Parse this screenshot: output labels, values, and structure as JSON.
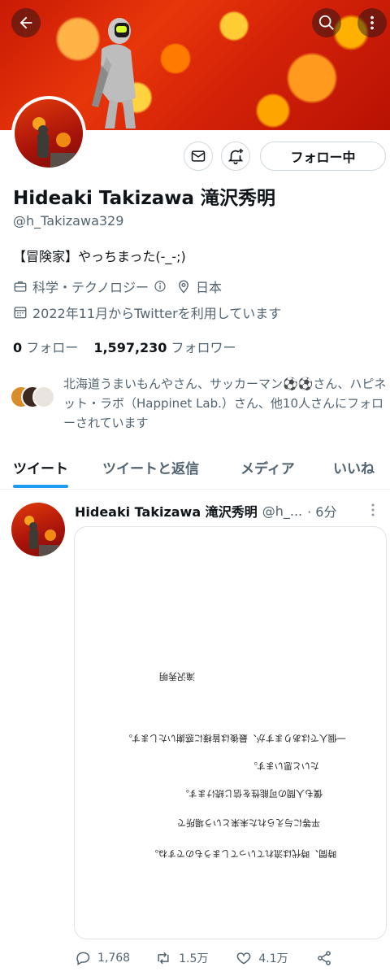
{
  "profile": {
    "name": "Hideaki Takizawa 滝沢秀明",
    "handle": "@h_Takizawa329",
    "bio": "【冒険家】やっちまった(-_-;)",
    "category": "科学・テクノロジー",
    "location": "日本",
    "joined": "2022年11月からTwitterを利用しています",
    "following_count": "0",
    "following_label": "フォロー",
    "followers_count": "1,597,230",
    "followers_label": "フォロワー",
    "follow_button": "フォロー中",
    "followed_by_text": "北海道うまいもんやさん、サッカーマン⚽⚽さん、ハピネット・ラボ（Happinet Lab.）さん、他10人さんにフォローされています"
  },
  "tabs": [
    {
      "label": "ツイート"
    },
    {
      "label": "ツイートと返信"
    },
    {
      "label": "メディア"
    },
    {
      "label": "いいね"
    }
  ],
  "tweet": {
    "name": "Hideaki Takizawa 滝沢秀明",
    "handle": "@h_...",
    "time": "· 6分",
    "image_lines": [
      "滝沢秀明",
      "一個人ではありますが、最後は皆様に惑謝いたします。",
      "たいと思います。",
      "僕も人間の可能性を信じ続けます。",
      "平等に与えられた未来という場所で",
      "時間、時代は流れていってしまうものですね。"
    ],
    "replies": "1,768",
    "retweets": "1.5万",
    "likes": "4.1万"
  },
  "colors": {
    "accent": "#1d9bf0",
    "text": "#0f1419",
    "secondary": "#536471",
    "border": "#cfd9de"
  }
}
